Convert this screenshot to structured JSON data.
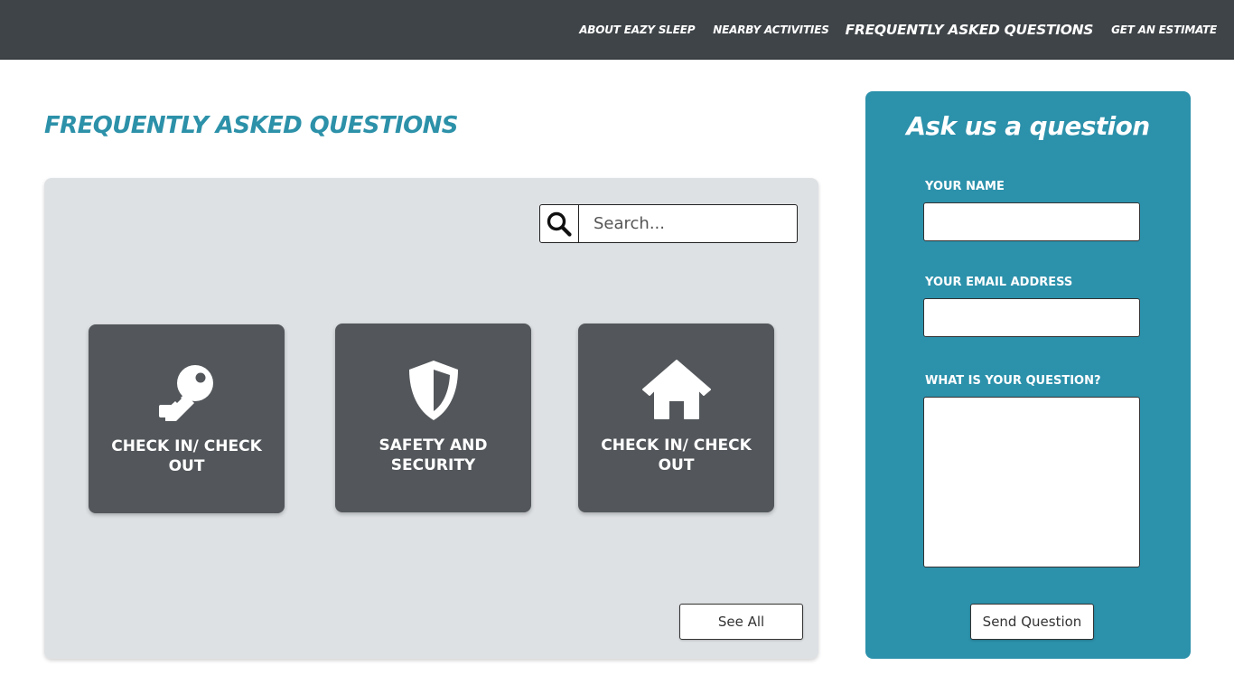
{
  "nav": {
    "items": [
      {
        "label": "ABOUT EAZY SLEEP",
        "active": false
      },
      {
        "label": "NEARBY ACTIVITIES",
        "active": false
      },
      {
        "label": "FREQUENTLY ASKED QUESTIONS",
        "active": true
      },
      {
        "label": "GET AN ESTIMATE",
        "active": false
      }
    ]
  },
  "main": {
    "title": "FREQUENTLY ASKED QUESTIONS",
    "search": {
      "placeholder": "Search...",
      "value": "",
      "icon": "search-icon"
    },
    "categories": [
      {
        "label": "CHECK IN/ CHECK OUT",
        "icon": "key-icon"
      },
      {
        "label": "SAFETY AND SECURITY",
        "icon": "shield-icon"
      },
      {
        "label": "CHECK IN/ CHECK OUT",
        "icon": "home-icon"
      }
    ],
    "see_all_label": "See All"
  },
  "ask": {
    "title": "Ask us a question",
    "name_label": "YOUR NAME",
    "name_value": "",
    "email_label": "YOUR EMAIL ADDRESS",
    "email_value": "",
    "question_label": "WHAT IS YOUR QUESTION?",
    "question_value": "",
    "send_label": "Send Question"
  },
  "colors": {
    "header_bg": "#3f4448",
    "accent": "#2c91a9",
    "panel_bg": "#dee1e4",
    "card_bg": "#53575b"
  }
}
